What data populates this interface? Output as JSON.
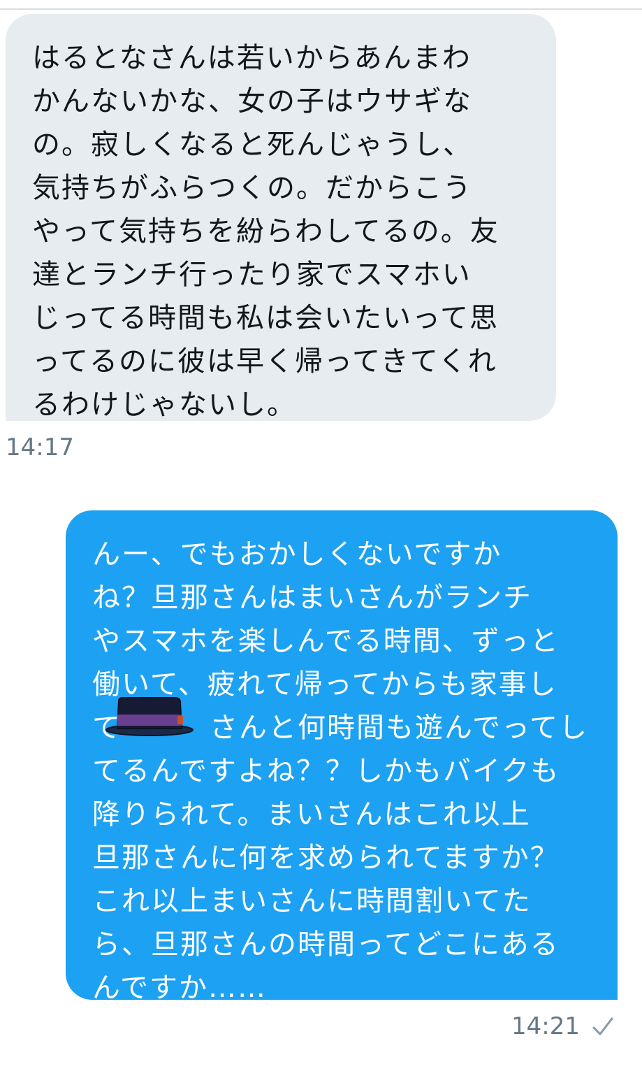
{
  "conversation": {
    "messages": [
      {
        "direction": "received",
        "lines": [
          "はるとなさんは若いからあんまわ",
          "かんないかな、女の子はウサギな",
          "の。寂しくなると死んじゃうし、",
          "気持ちがふらつくの。だからこう",
          "やって気持ちを紛らわしてるの。友",
          "達とランチ行ったり家でスマホい",
          "じってる時間も私は会いたいって思",
          "ってるのに彼は早く帰ってきてくれ",
          "るわけじゃないし。"
        ],
        "time": "14:17"
      },
      {
        "direction": "sent",
        "lines": [
          "んー、でもおかしくないですか",
          "ね？旦那さんはまいさんがランチ",
          "やスマホを楽しんでる時間、ずっと",
          "働いて、疲れて帰ってからも家事し",
          "て　　　さんと何時間も遊んでってし",
          "てるんですよね？？しかもバイクも",
          "降りられて。まいさんはこれ以上",
          "旦那さんに何を求められてますか？",
          "これ以上まいさんに時間割いてた",
          "ら、旦那さんの時間ってどこにある",
          "んですか……"
        ],
        "time": "14:21",
        "status_icon": "checkmark-icon"
      }
    ]
  },
  "colors": {
    "received_bubble": "#e6ecf0",
    "sent_bubble": "#1da1f2",
    "timestamp": "#657786"
  }
}
